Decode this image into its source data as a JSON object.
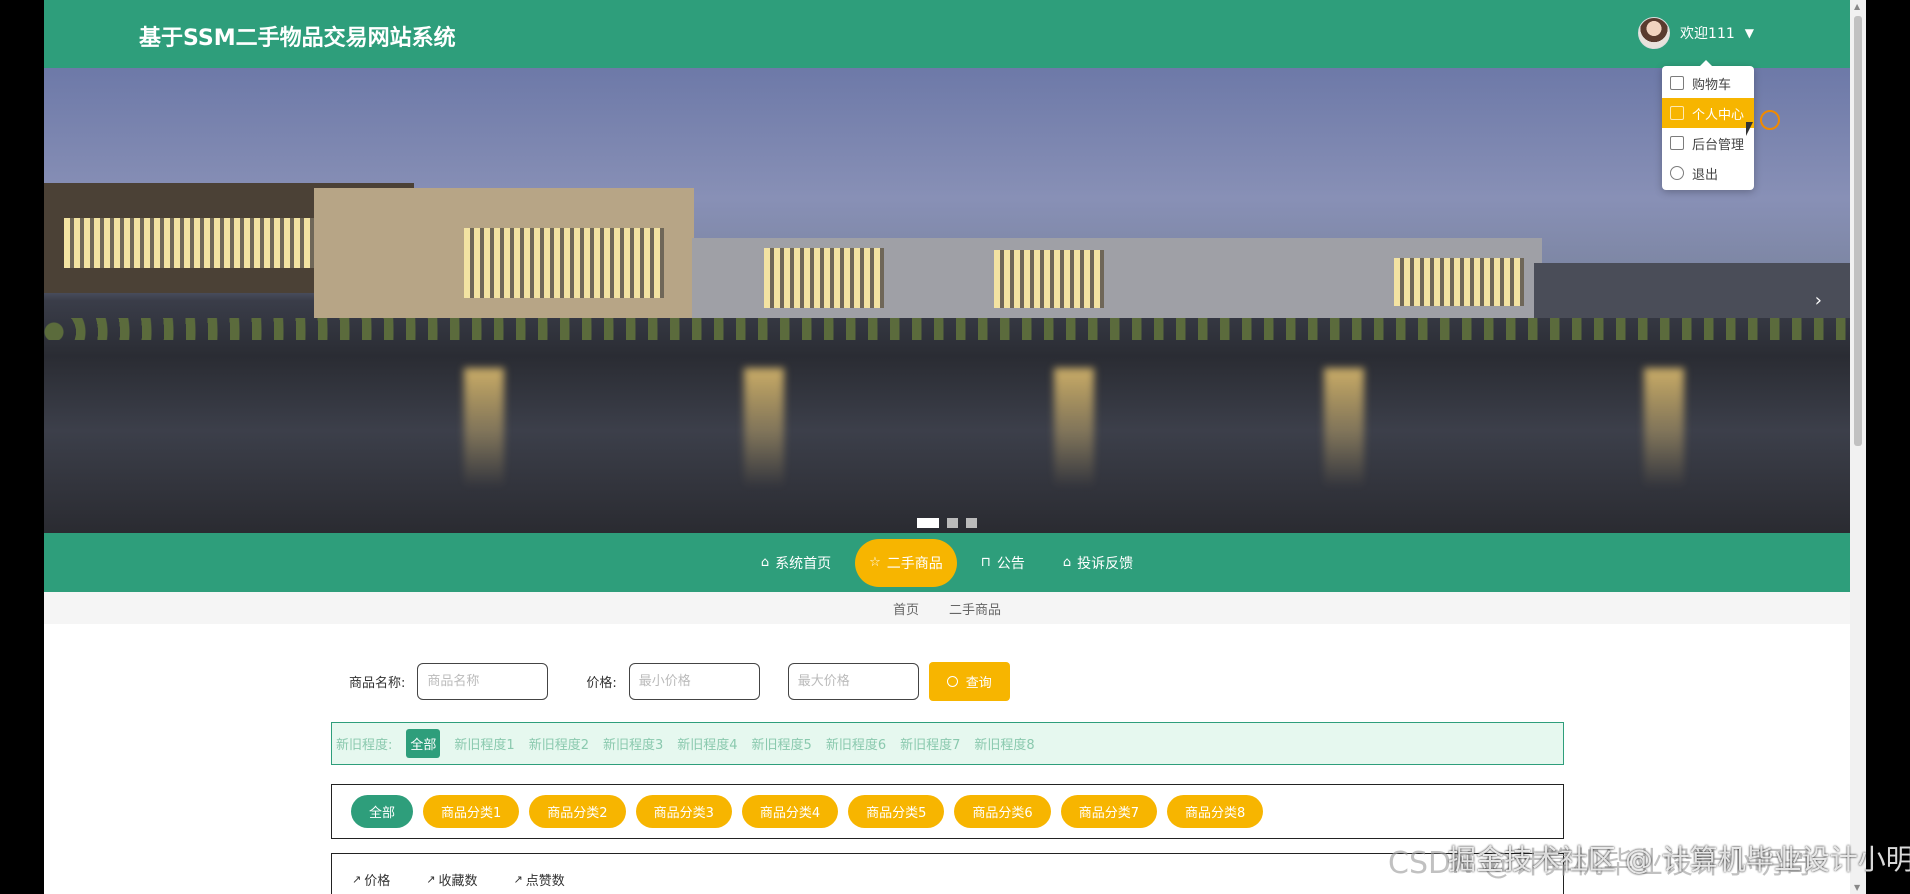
{
  "header": {
    "site_title": "基于SSM二手物品交易网站系统",
    "welcome": "欢迎111"
  },
  "user_menu": {
    "items": [
      {
        "label": "购物车",
        "icon": "cart-icon",
        "active": false
      },
      {
        "label": "个人中心",
        "icon": "user-icon",
        "active": true
      },
      {
        "label": "后台管理",
        "icon": "grid-icon",
        "active": false
      },
      {
        "label": "退出",
        "icon": "clock-icon",
        "active": false
      }
    ]
  },
  "banner": {
    "slides": 3,
    "current": 1
  },
  "nav": {
    "items": [
      {
        "label": "系统首页",
        "icon": "home-icon",
        "active": false
      },
      {
        "label": "二手商品",
        "icon": "star-icon",
        "active": true
      },
      {
        "label": "公告",
        "icon": "bag-icon",
        "active": false
      },
      {
        "label": "投诉反馈",
        "icon": "home-icon",
        "active": false
      }
    ]
  },
  "breadcrumb": [
    "首页",
    "二手商品"
  ],
  "search": {
    "name_label": "商品名称:",
    "name_placeholder": "商品名称",
    "price_label": "价格:",
    "min_placeholder": "最小价格",
    "max_placeholder": "最大价格",
    "query_label": "查询"
  },
  "condition_filter": {
    "label": "新旧程度:",
    "options": [
      "全部",
      "新旧程度1",
      "新旧程度2",
      "新旧程度3",
      "新旧程度4",
      "新旧程度5",
      "新旧程度6",
      "新旧程度7",
      "新旧程度8"
    ],
    "selected": 0
  },
  "category_filter": {
    "options": [
      "全部",
      "商品分类1",
      "商品分类2",
      "商品分类3",
      "商品分类4",
      "商品分类5",
      "商品分类6",
      "商品分类7",
      "商品分类8"
    ],
    "selected": 0
  },
  "sort": [
    "价格",
    "收藏数",
    "点赞数"
  ],
  "watermark": "掘金技术社区 @ 计算机毕业设计小明哥",
  "watermark_shadow": "CSDN @计算机毕业设计小明哥",
  "colors": {
    "primary": "#2e9e7b",
    "accent": "#f7b500"
  }
}
